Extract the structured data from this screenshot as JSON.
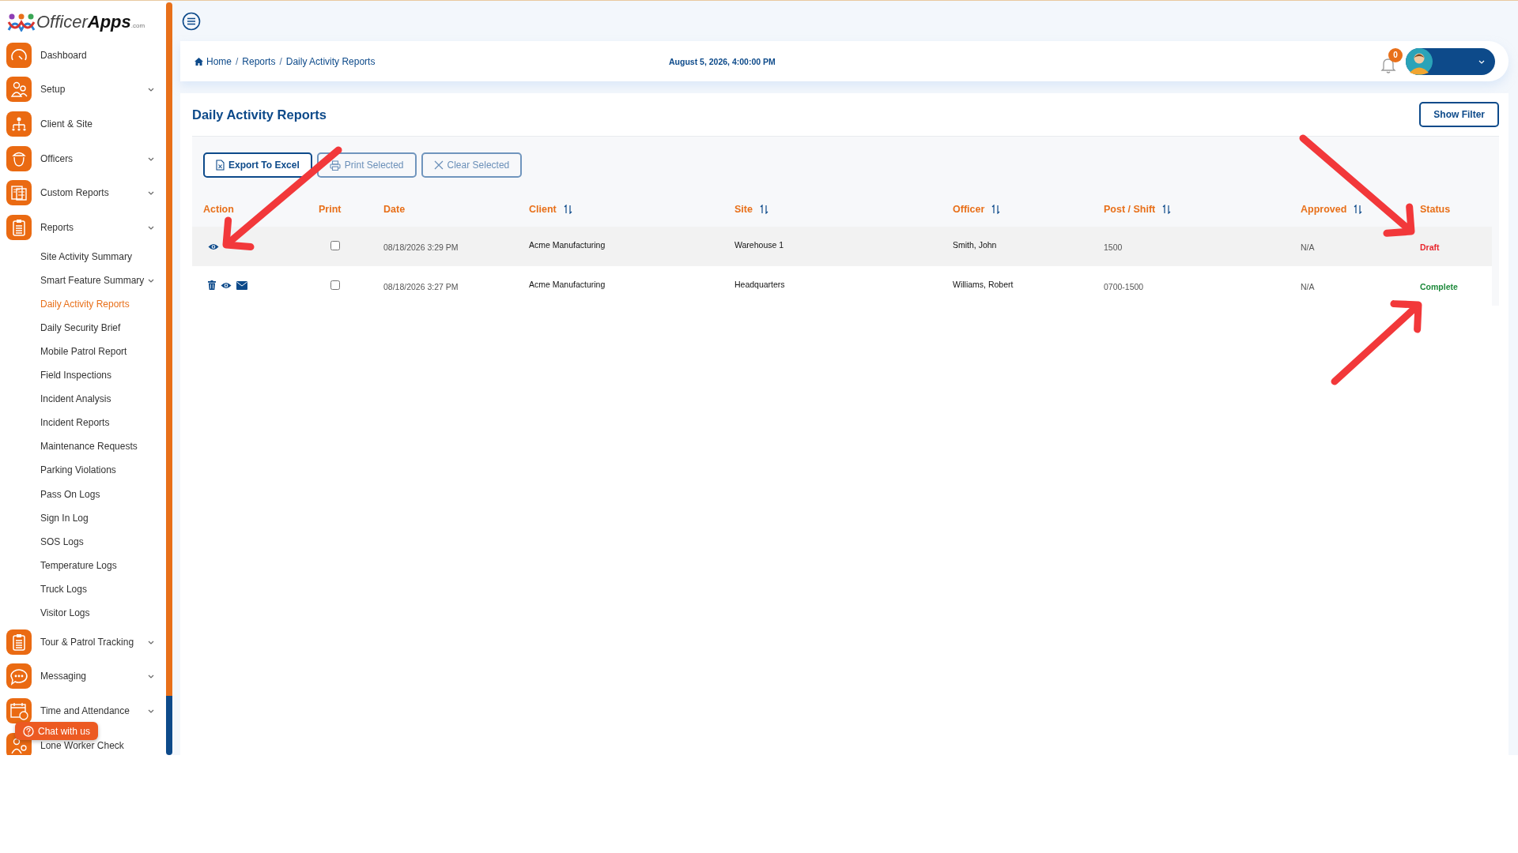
{
  "sidebar": {
    "logo": {
      "text_light": "Officer",
      "text_bold": "Apps",
      "suffix": ".com"
    },
    "items": [
      {
        "label": "Dashboard",
        "expandable": false,
        "selected": false
      },
      {
        "label": "Setup",
        "expandable": true,
        "selected": false
      },
      {
        "label": "Client & Site",
        "expandable": false,
        "selected": false
      },
      {
        "label": "Officers",
        "expandable": true,
        "selected": false
      },
      {
        "label": "Custom Reports",
        "expandable": true,
        "selected": false
      },
      {
        "label": "Reports",
        "expandable": true,
        "selected": false,
        "children": [
          {
            "label": "Site Activity Summary",
            "expandable": false,
            "selected": false
          },
          {
            "label": "Smart Feature Summary",
            "expandable": true,
            "selected": false
          },
          {
            "label": "Daily Activity Reports",
            "expandable": false,
            "selected": true
          },
          {
            "label": "Daily Security Brief",
            "expandable": false,
            "selected": false
          },
          {
            "label": "Mobile Patrol Report",
            "expandable": false,
            "selected": false
          },
          {
            "label": "Field Inspections",
            "expandable": false,
            "selected": false
          },
          {
            "label": "Incident Analysis",
            "expandable": false,
            "selected": false
          },
          {
            "label": "Incident Reports",
            "expandable": false,
            "selected": false
          },
          {
            "label": "Maintenance Requests",
            "expandable": false,
            "selected": false
          },
          {
            "label": "Parking Violations",
            "expandable": false,
            "selected": false
          },
          {
            "label": "Pass On Logs",
            "expandable": false,
            "selected": false
          },
          {
            "label": "Sign In Log",
            "expandable": false,
            "selected": false
          },
          {
            "label": "SOS Logs",
            "expandable": false,
            "selected": false
          },
          {
            "label": "Temperature Logs",
            "expandable": false,
            "selected": false
          },
          {
            "label": "Truck Logs",
            "expandable": false,
            "selected": false
          },
          {
            "label": "Visitor Logs",
            "expandable": false,
            "selected": false
          }
        ]
      },
      {
        "label": "Tour & Patrol Tracking",
        "expandable": true,
        "selected": false
      },
      {
        "label": "Messaging",
        "expandable": true,
        "selected": false
      },
      {
        "label": "Time and Attendance",
        "expandable": true,
        "selected": false
      },
      {
        "label": "Lone Worker Check",
        "expandable": false,
        "selected": false
      }
    ],
    "chat_button": "Chat with us"
  },
  "header": {
    "breadcrumb": [
      {
        "kind": "link",
        "text": "Home"
      },
      {
        "kind": "separator",
        "text": "/"
      },
      {
        "kind": "link",
        "text": "Reports"
      },
      {
        "kind": "separator",
        "text": "/"
      },
      {
        "kind": "link",
        "text": "Daily Activity Reports"
      }
    ],
    "datetime": "August 5, 2026, 4:00:00 PM",
    "notification_count": "0"
  },
  "page": {
    "title": "Daily Activity Reports",
    "filter_button": "Show Filter",
    "toolbar": [
      {
        "label": "Export To Excel",
        "kind": "excel",
        "disabled": false
      },
      {
        "label": "Print Selected",
        "kind": "print",
        "disabled": true
      },
      {
        "label": "Clear Selected",
        "kind": "clear",
        "disabled": true
      }
    ],
    "table": {
      "columns": [
        {
          "label": "Action",
          "sortable": false
        },
        {
          "label": "Print",
          "sortable": false
        },
        {
          "label": "Date",
          "sortable": false
        },
        {
          "label": "Client",
          "sortable": true
        },
        {
          "label": "Site",
          "sortable": true
        },
        {
          "label": "Officer",
          "sortable": true
        },
        {
          "label": "Post / Shift",
          "sortable": true
        },
        {
          "label": "Approved",
          "sortable": true
        },
        {
          "label": "Status",
          "sortable": false
        }
      ],
      "rows": [
        {
          "actions": [
            {
              "kind": "view"
            }
          ],
          "checked": false,
          "date": "08/18/2026 3:29 PM",
          "client": "Acme Manufacturing",
          "site": "Warehouse 1",
          "officer": "Smith, John",
          "post_shift": "1500",
          "approved": "N/A",
          "status": "Draft",
          "color": "#e8262d",
          "highlighted": true
        },
        {
          "actions": [
            {
              "kind": "delete"
            },
            {
              "kind": "view"
            },
            {
              "kind": "email"
            }
          ],
          "checked": false,
          "date": "08/18/2026 3:27 PM",
          "client": "Acme Manufacturing",
          "site": "Headquarters",
          "officer": "Williams, Robert",
          "post_shift": "0700-1500",
          "approved": "N/A",
          "status": "Complete",
          "color": "#1e8a3c",
          "highlighted": false
        }
      ]
    }
  },
  "annotations": [
    {
      "kind": "arrow"
    },
    {
      "kind": "arrow"
    },
    {
      "kind": "arrow"
    }
  ]
}
